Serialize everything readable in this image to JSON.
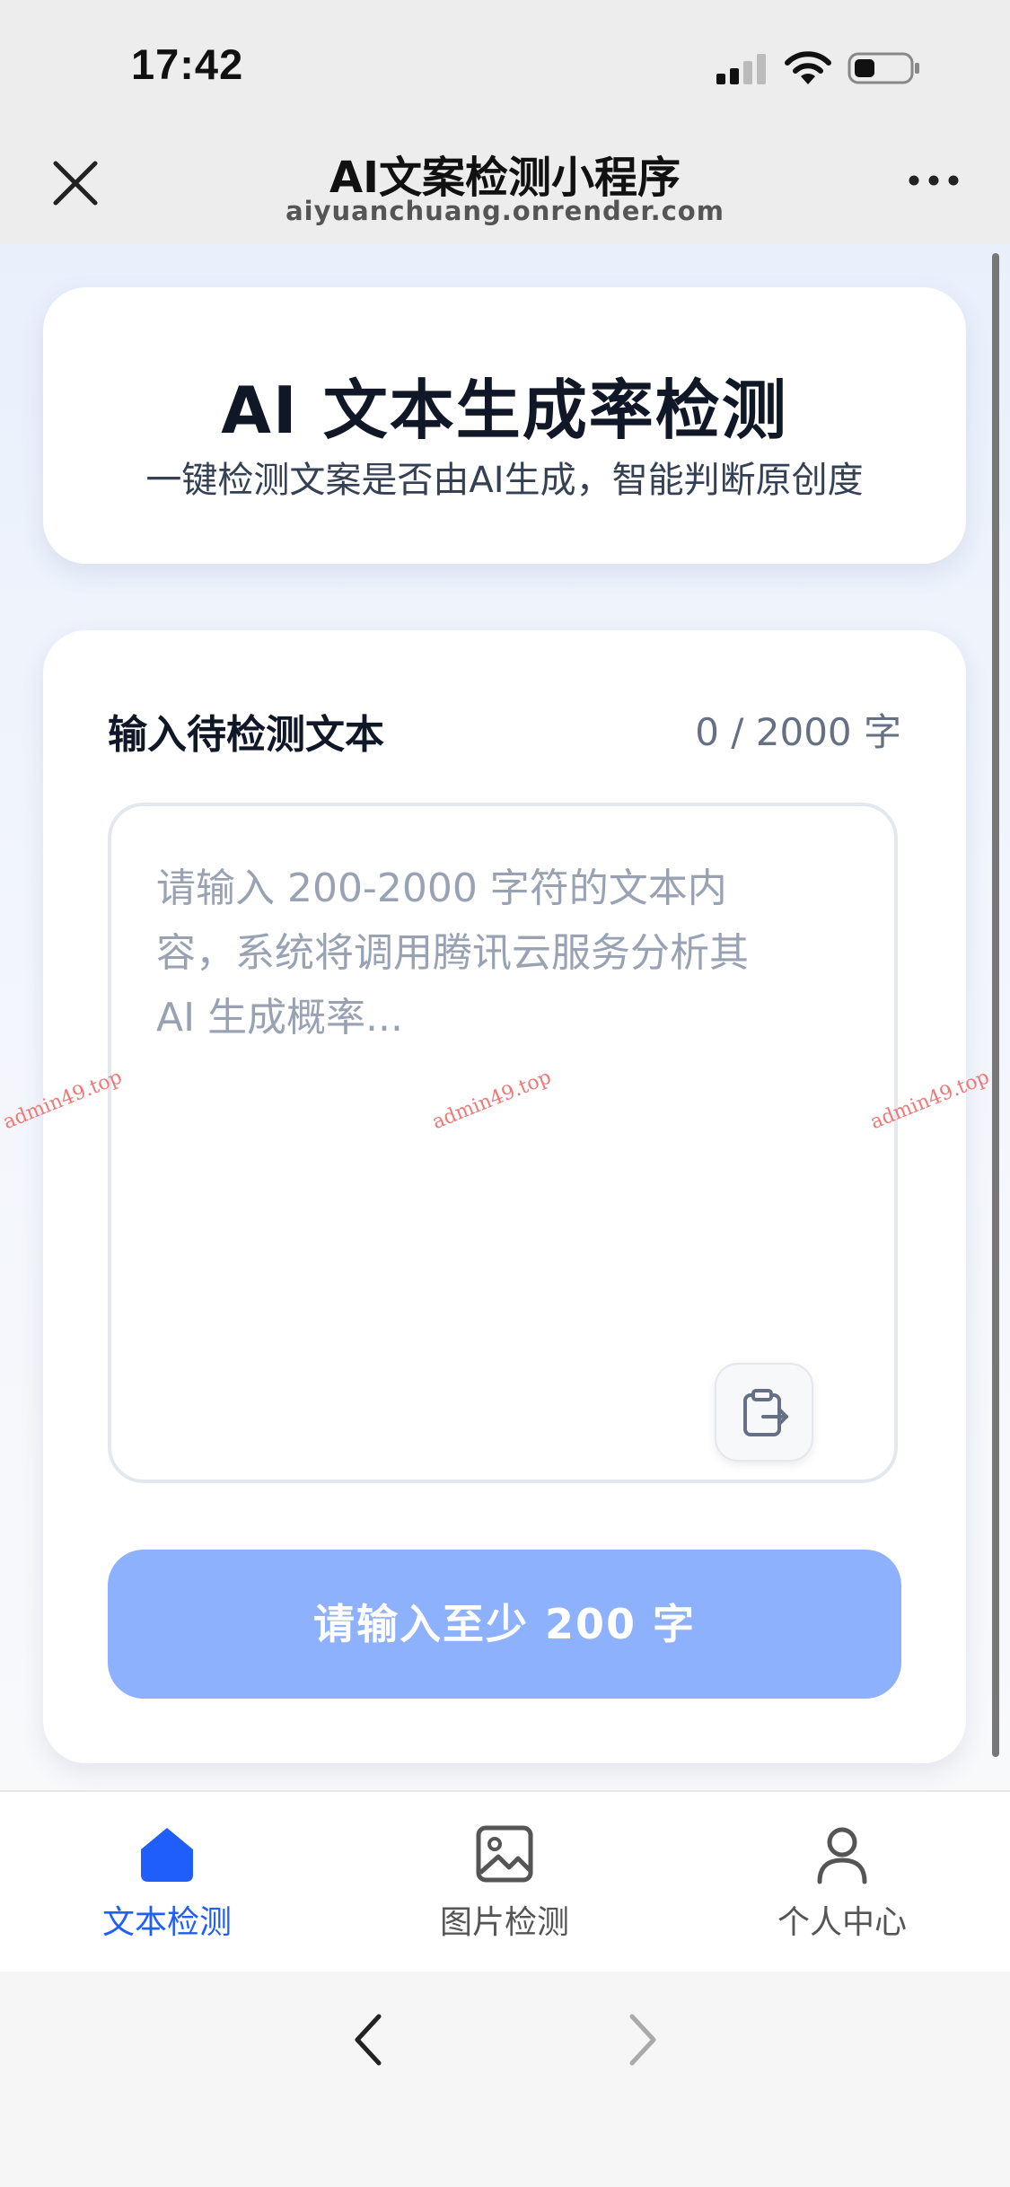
{
  "status_bar": {
    "time": "17:42"
  },
  "nav": {
    "title": "AI文案检测小程序",
    "subtitle": "aiyuanchuang.onrender.com"
  },
  "header_card": {
    "title": "AI 文本生成率检测",
    "subtitle": "一键检测文案是否由AI生成，智能判断原创度"
  },
  "input_card": {
    "label": "输入待检测文本",
    "counter": "0 / 2000 字",
    "placeholder": "请输入 200-2000 字符的文本内容，系统将调用腾讯云服务分析其 AI 生成概率...",
    "submit_label": "请输入至少 200 字"
  },
  "watermark": "admin49.top",
  "tabs": [
    {
      "label": "文本检测",
      "icon": "home-icon",
      "active": true
    },
    {
      "label": "图片检测",
      "icon": "image-icon",
      "active": false
    },
    {
      "label": "个人中心",
      "icon": "user-icon",
      "active": false
    }
  ],
  "colors": {
    "accent": "#1f5efa",
    "button_disabled": "#8db1fc",
    "watermark": "#f07878"
  }
}
